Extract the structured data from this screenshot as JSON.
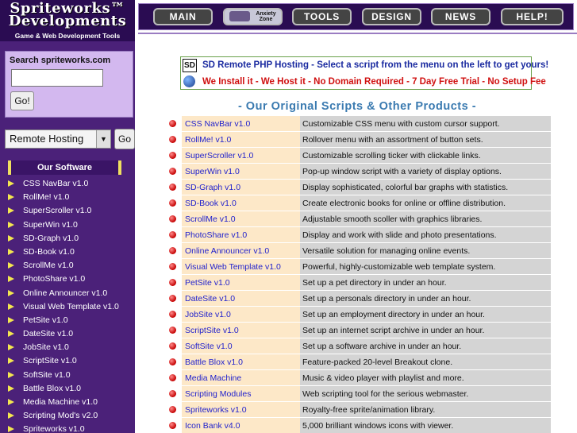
{
  "logo": {
    "line1": "Spriteworks™",
    "line2": "Developments",
    "tagline": "Game & Web Development Tools"
  },
  "nav": {
    "main": "MAIN",
    "anxiety": "Anxiety Zone",
    "tools": "TOOLS",
    "design": "DESIGN",
    "news": "NEWS",
    "help": "HELP!"
  },
  "search": {
    "label": "Search spriteworks.com",
    "value": "",
    "button": "Go!"
  },
  "hosting": {
    "selected": "Remote Hosting",
    "button": "Go"
  },
  "software": {
    "heading": "Our Software",
    "items": [
      "CSS NavBar v1.0",
      "RollMe! v1.0",
      "SuperScroller v1.0",
      "SuperWin v1.0",
      "SD-Graph v1.0",
      "SD-Book v1.0",
      "ScrollMe v1.0",
      "PhotoShare v1.0",
      "Online Announcer v1.0",
      "Visual Web Template v1.0",
      "PetSite v1.0",
      "DateSite v1.0",
      "JobSite v1.0",
      "ScriptSite v1.0",
      "SoftSite v1.0",
      "Battle Blox v1.0",
      "Media Machine v1.0",
      "Scripting Mod's v2.0",
      "Spriteworks v1.0"
    ]
  },
  "banner": {
    "logo_text": "SD",
    "line1": "SD Remote PHP Hosting - Select a script from the menu on the left to get yours!",
    "line2": "We Install it - We Host it - No Domain Required - 7 Day Free Trial - No Setup Fee"
  },
  "products": {
    "heading": "- Our Original Scripts & Other Products -",
    "rows": [
      {
        "name": "CSS NavBar v1.0",
        "desc": "Customizable CSS menu with custom cursor support."
      },
      {
        "name": "RollMe! v1.0",
        "desc": "Rollover menu with an assortment of button sets."
      },
      {
        "name": "SuperScroller v1.0",
        "desc": "Customizable scrolling ticker with clickable links."
      },
      {
        "name": "SuperWin v1.0",
        "desc": "Pop-up window script with a variety of display options."
      },
      {
        "name": "SD-Graph v1.0",
        "desc": "Display sophisticated, colorful bar graphs with statistics."
      },
      {
        "name": "SD-Book v1.0",
        "desc": "Create electronic books for online or offline distribution."
      },
      {
        "name": "ScrollMe v1.0",
        "desc": "Adjustable smooth scoller with graphics libraries."
      },
      {
        "name": "PhotoShare v1.0",
        "desc": "Display and work with slide and photo presentations."
      },
      {
        "name": "Online Announcer v1.0",
        "desc": "Versatile solution for managing online events."
      },
      {
        "name": "Visual Web Template v1.0",
        "desc": "Powerful, highly-customizable web template system."
      },
      {
        "name": "PetSite v1.0",
        "desc": "Set up a pet directory in under an hour."
      },
      {
        "name": "DateSite v1.0",
        "desc": "Set up a personals directory in under an hour."
      },
      {
        "name": "JobSite v1.0",
        "desc": "Set up an employment directory in under an hour."
      },
      {
        "name": "ScriptSite v1.0",
        "desc": "Set up an internet script archive in under an hour."
      },
      {
        "name": "SoftSite v1.0",
        "desc": "Set up a software archive in under an hour."
      },
      {
        "name": "Battle Blox v1.0",
        "desc": "Feature-packed 20-level Breakout clone."
      },
      {
        "name": "Media Machine",
        "desc": "Music & video player with playlist and more."
      },
      {
        "name": "Scripting Modules",
        "desc": "Web scripting tool for the serious webmaster."
      },
      {
        "name": "Spriteworks v1.0",
        "desc": "Royalty-free sprite/animation library."
      },
      {
        "name": "Icon Bank v4.0",
        "desc": "5,000 brilliant windows icons with viewer."
      }
    ]
  }
}
